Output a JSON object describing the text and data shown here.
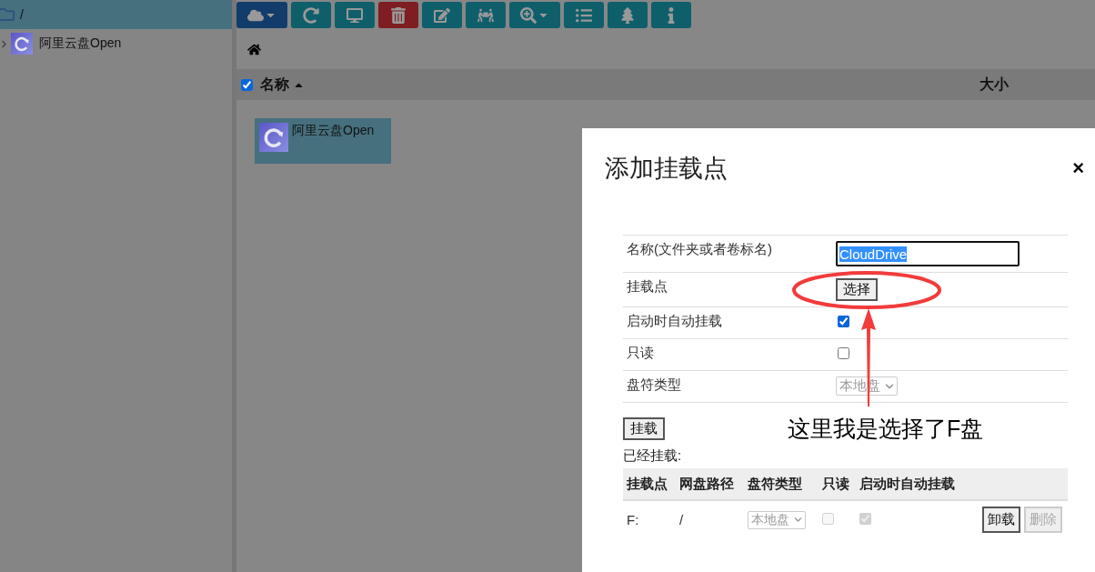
{
  "sidebar": {
    "root": {
      "label": "/",
      "selected": true
    },
    "tree": [
      {
        "label": "阿里云盘Open",
        "expanded": false
      }
    ]
  },
  "toolbar": [
    {
      "kind": "primary",
      "dropdown": true
    },
    {
      "kind": "info",
      "dropdown": false
    },
    {
      "kind": "info",
      "dropdown": false
    },
    {
      "kind": "danger",
      "dropdown": false
    },
    {
      "kind": "info",
      "dropdown": false
    },
    {
      "kind": "info",
      "dropdown": false
    },
    {
      "kind": "info",
      "dropdown": true
    },
    {
      "kind": "info",
      "dropdown": false
    },
    {
      "kind": "info",
      "dropdown": false
    },
    {
      "kind": "info",
      "dropdown": false
    }
  ],
  "file_list": {
    "select_all_checked": true,
    "columns": [
      {
        "label": "名称",
        "sorted": true
      },
      {
        "label": "大小",
        "sorted": false
      }
    ],
    "items": [
      {
        "name": "阿里云盘Open",
        "selected": true
      }
    ]
  },
  "dialog": {
    "title": "添加挂载点",
    "close": "×",
    "form": [
      {
        "kind": "text",
        "label": "名称(文件夹或者卷标名)",
        "value": "CloudDrive",
        "text_selected": true
      },
      {
        "kind": "button",
        "label": "挂载点",
        "button": "选择"
      },
      {
        "kind": "checkbox",
        "label": "启动时自动挂载",
        "checked": true
      },
      {
        "kind": "checkbox",
        "label": "只读",
        "checked": false
      },
      {
        "kind": "select",
        "label": "盘符类型",
        "value": "本地盘",
        "disabled": true
      }
    ],
    "mount_button": "挂载",
    "mounted_label": "已经挂载:",
    "mounted_table": {
      "columns": [
        "挂载点",
        "网盘路径",
        "盘符类型",
        "只读",
        "启动时自动挂载"
      ],
      "rows": [
        {
          "mount_point": "F:",
          "path": "/",
          "drive_type": "本地盘",
          "read_only": false,
          "auto_mount": true,
          "actions": [
            {
              "label": "卸载",
              "disabled": false
            },
            {
              "label": "删除",
              "disabled": true
            }
          ]
        }
      ]
    }
  },
  "annotation": {
    "text": "这里我是选择了F盘"
  }
}
